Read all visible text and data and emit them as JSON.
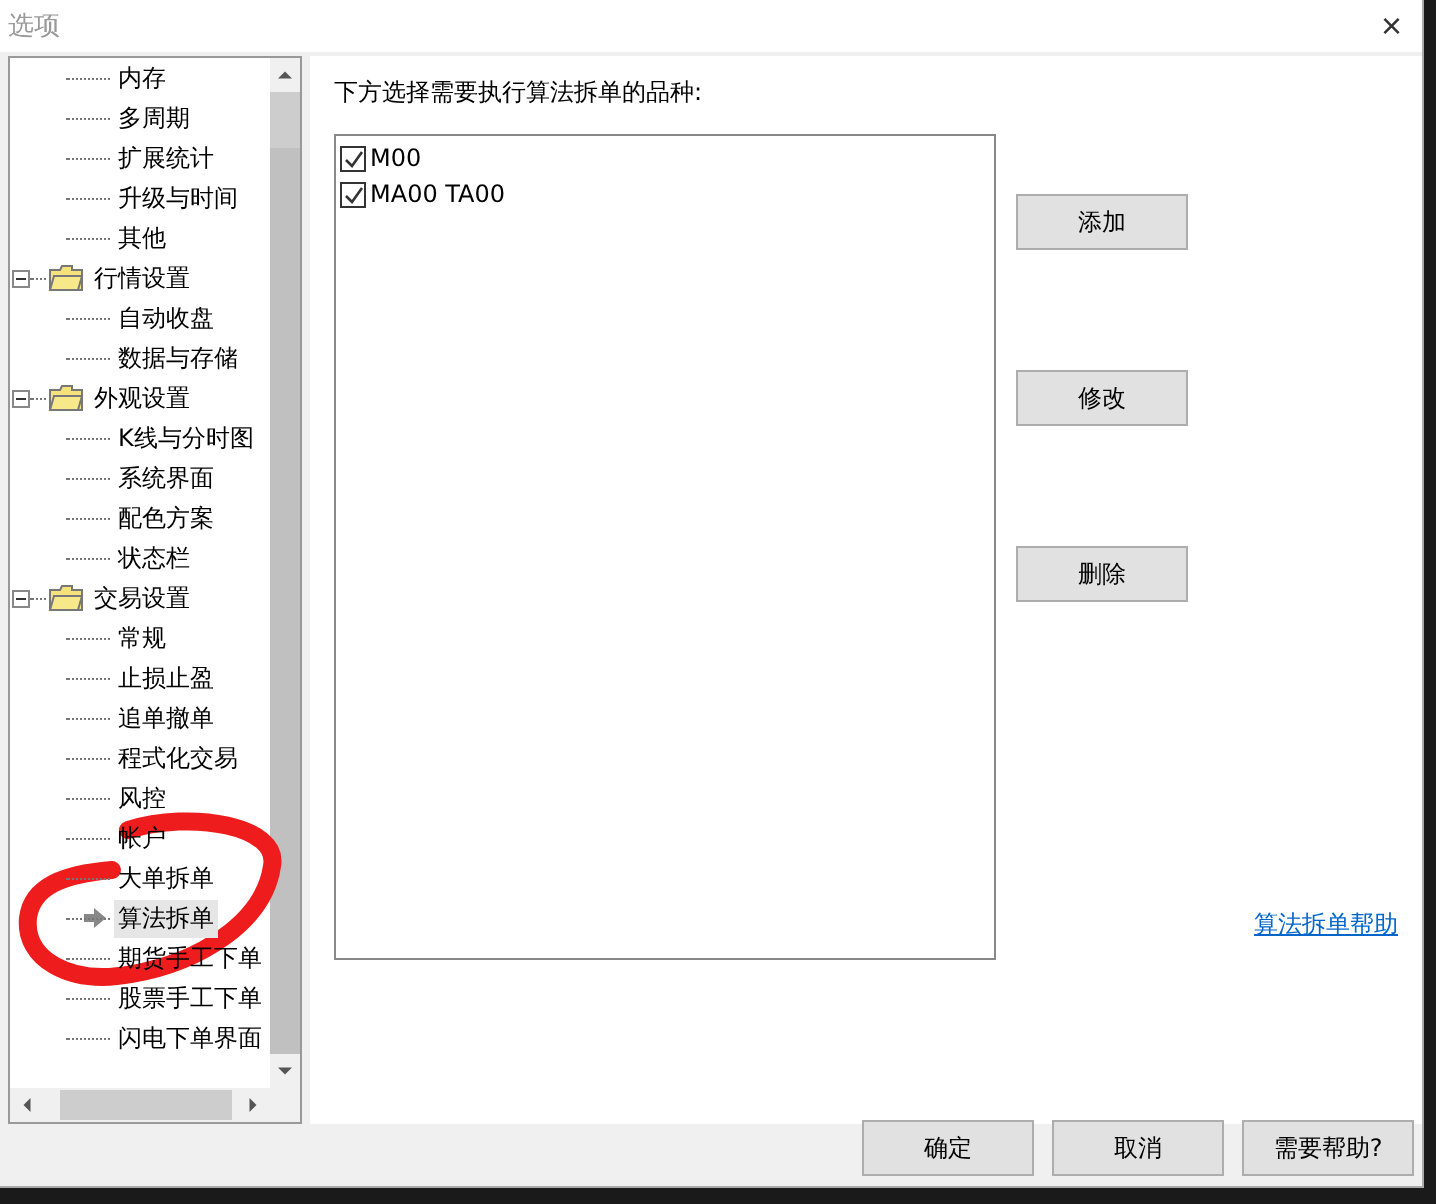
{
  "window": {
    "title": "选项",
    "close": "×"
  },
  "tree": [
    {
      "children": [
        {
          "label": "内存",
          "selected": false
        },
        {
          "label": "多周期",
          "selected": false
        },
        {
          "label": "扩展统计",
          "selected": false
        },
        {
          "label": "升级与时间",
          "selected": false
        },
        {
          "label": "其他",
          "selected": false
        }
      ]
    },
    {
      "label": "行情设置",
      "expanded": true,
      "children": [
        {
          "label": "自动收盘",
          "selected": false
        },
        {
          "label": "数据与存储",
          "selected": false
        }
      ]
    },
    {
      "label": "外观设置",
      "expanded": true,
      "children": [
        {
          "label": "K线与分时图",
          "selected": false
        },
        {
          "label": "系统界面",
          "selected": false
        },
        {
          "label": "配色方案",
          "selected": false
        },
        {
          "label": "状态栏",
          "selected": false
        }
      ]
    },
    {
      "label": "交易设置",
      "expanded": true,
      "children": [
        {
          "label": "常规",
          "selected": false
        },
        {
          "label": "止损止盈",
          "selected": false
        },
        {
          "label": "追单撤单",
          "selected": false
        },
        {
          "label": "程式化交易",
          "selected": false
        },
        {
          "label": "风控",
          "selected": false
        },
        {
          "label": "帐户",
          "selected": false
        },
        {
          "label": "大单拆单",
          "selected": false
        },
        {
          "label": "算法拆单",
          "selected": true
        },
        {
          "label": "期货手工下单",
          "selected": false
        },
        {
          "label": "股票手工下单",
          "selected": false
        },
        {
          "label": "闪电下单界面",
          "selected": false
        }
      ]
    }
  ],
  "panel": {
    "instruction": "下方选择需要执行算法拆单的品种:",
    "symbols": [
      {
        "label": "M00",
        "checked": true
      },
      {
        "label": "MA00 TA00",
        "checked": true
      }
    ],
    "side_buttons": [
      "添加",
      "修改",
      "删除"
    ],
    "help_link": "算法拆单帮助"
  },
  "annotation": {
    "kind": "circle"
  },
  "buttons": [
    "确定",
    "取消",
    "需要帮助?"
  ]
}
